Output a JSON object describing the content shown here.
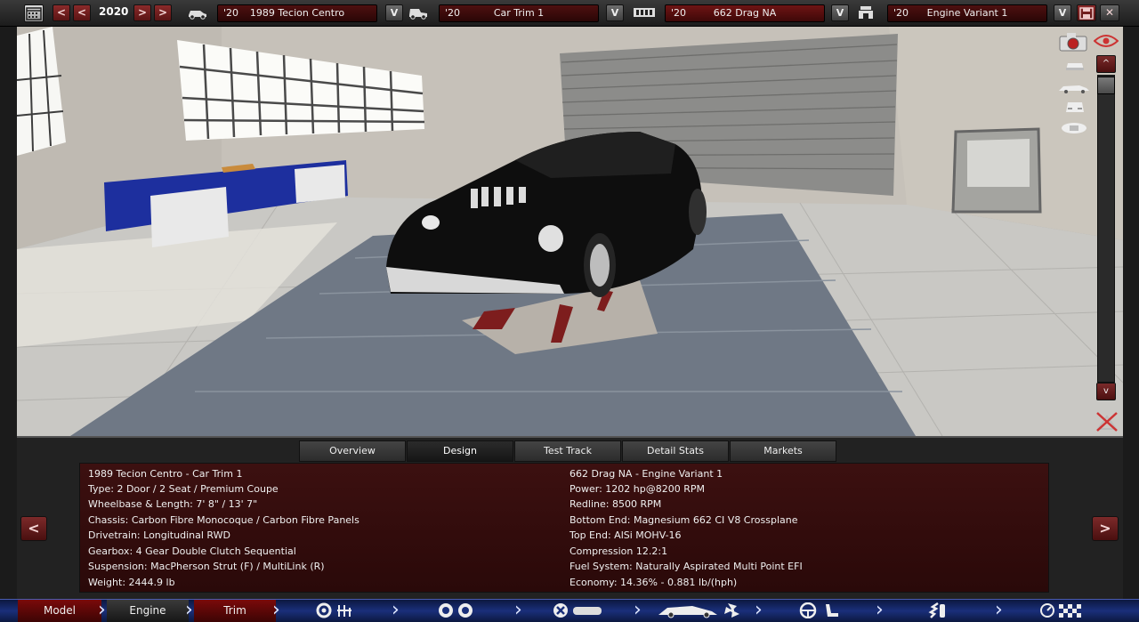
{
  "toolbar": {
    "calendar_icon": "calendar-icon",
    "year": "2020",
    "prev_far": "<",
    "prev": "<",
    "next": ">",
    "next_far": ">",
    "model": {
      "year": "'20",
      "name": "1989 Tecion Centro"
    },
    "trim": {
      "year": "'20",
      "name": "Car Trim 1"
    },
    "engine": {
      "year": "'20",
      "name": "662 Drag NA"
    },
    "variant": {
      "year": "'20",
      "name": "Engine Variant 1"
    },
    "dropdown": "V",
    "close": "✕"
  },
  "viewport": {
    "scroll_up": "^",
    "scroll_down": "v"
  },
  "tabs": [
    "Overview",
    "Design",
    "Test Track",
    "Detail Stats",
    "Markets"
  ],
  "active_tab": "Design",
  "info_left": [
    "1989 Tecion Centro  - Car Trim 1",
    "Type: 2 Door / 2 Seat / Premium Coupe",
    "Wheelbase & Length: 7' 8\" / 13' 7\"",
    "Chassis: Carbon Fibre Monocoque / Carbon Fibre Panels",
    "Drivetrain: Longitudinal RWD",
    "Gearbox: 4 Gear Double Clutch Sequential",
    "Suspension: MacPherson Strut (F) / MultiLink (R)",
    "Weight: 2444.9 lb"
  ],
  "info_right": [
    "662 Drag NA - Engine Variant 1",
    "Power: 1202 hp@8200 RPM",
    "Redline: 8500 RPM",
    "Bottom End: Magnesium 662 CI V8 Crossplane",
    "Top End: AlSi MOHV-16",
    "Compression 12.2:1",
    "Fuel System: Naturally Aspirated Multi Point EFI",
    "Economy: 14.36% - 0.881 lb/(hph)"
  ],
  "panel_nav": {
    "prev": "<",
    "next": ">"
  },
  "nav": {
    "model": "Model",
    "engine": "Engine",
    "trim": "Trim",
    "chevron": "›"
  }
}
